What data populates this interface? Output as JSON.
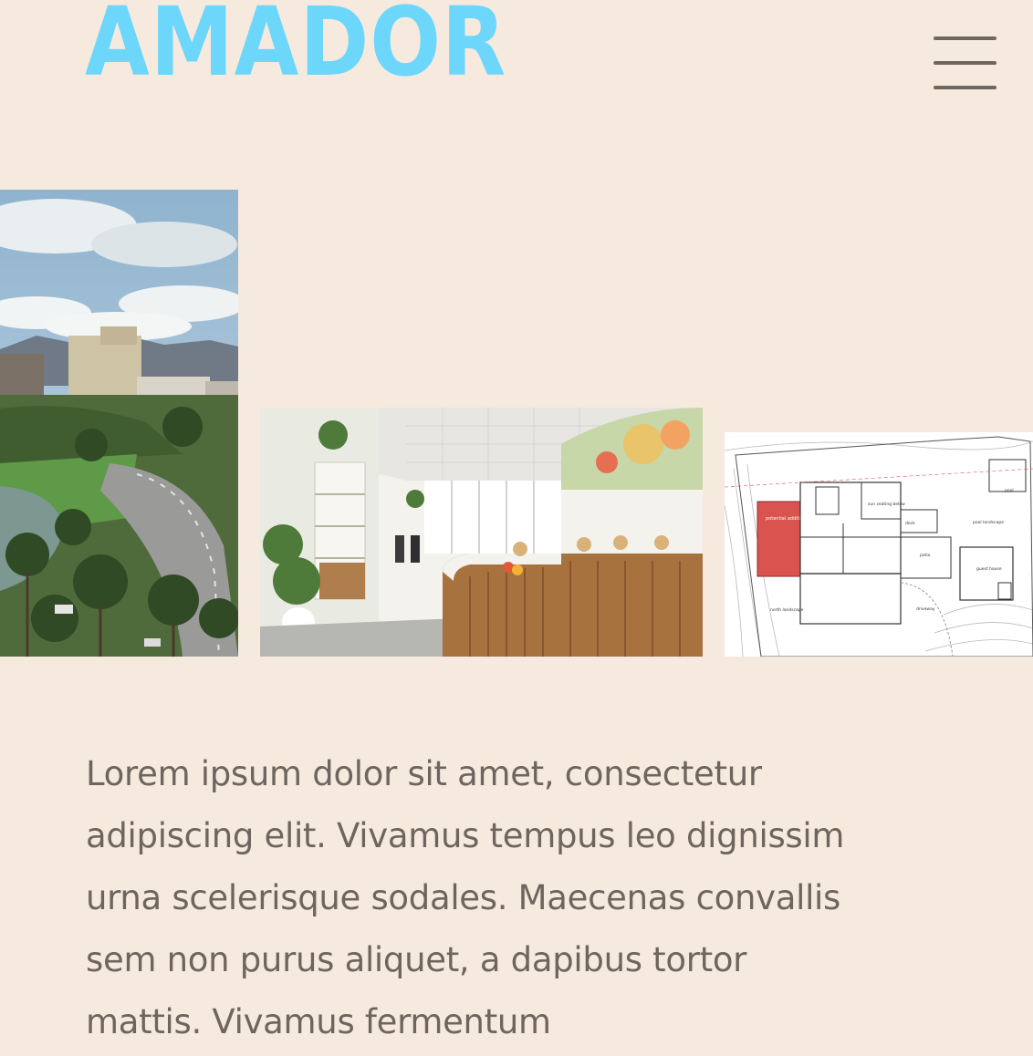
{
  "header": {
    "logo_text": "AMADÒR",
    "logo_color": "#6dd6fb",
    "menu_icon": "hamburger-menu-icon"
  },
  "gallery": {
    "images": [
      {
        "name": "city-park-photo"
      },
      {
        "name": "cafe-interior-photo"
      },
      {
        "name": "floor-plan-drawing"
      }
    ]
  },
  "floor_plan": {
    "labels": {
      "potential_addition": "potential addition",
      "sun_seating": "sun seating below",
      "deck": "deck",
      "pool": "pool",
      "pool_landscape": "pool landscape",
      "patio": "patio",
      "guest_house": "guest house",
      "north_landscape": "north landscape",
      "driveway": "driveway"
    },
    "highlight_color": "#d9534f"
  },
  "body": {
    "intro_text": "Lorem ipsum dolor sit amet, consectetur adipiscing elit. Vivamus tempus leo dignissim urna scelerisque sodales. Maecenas convallis sem non purus aliquet, a dapibus tortor mattis. Vivamus fermentum"
  },
  "colors": {
    "background": "#f6eadf",
    "text": "#6e665e"
  }
}
